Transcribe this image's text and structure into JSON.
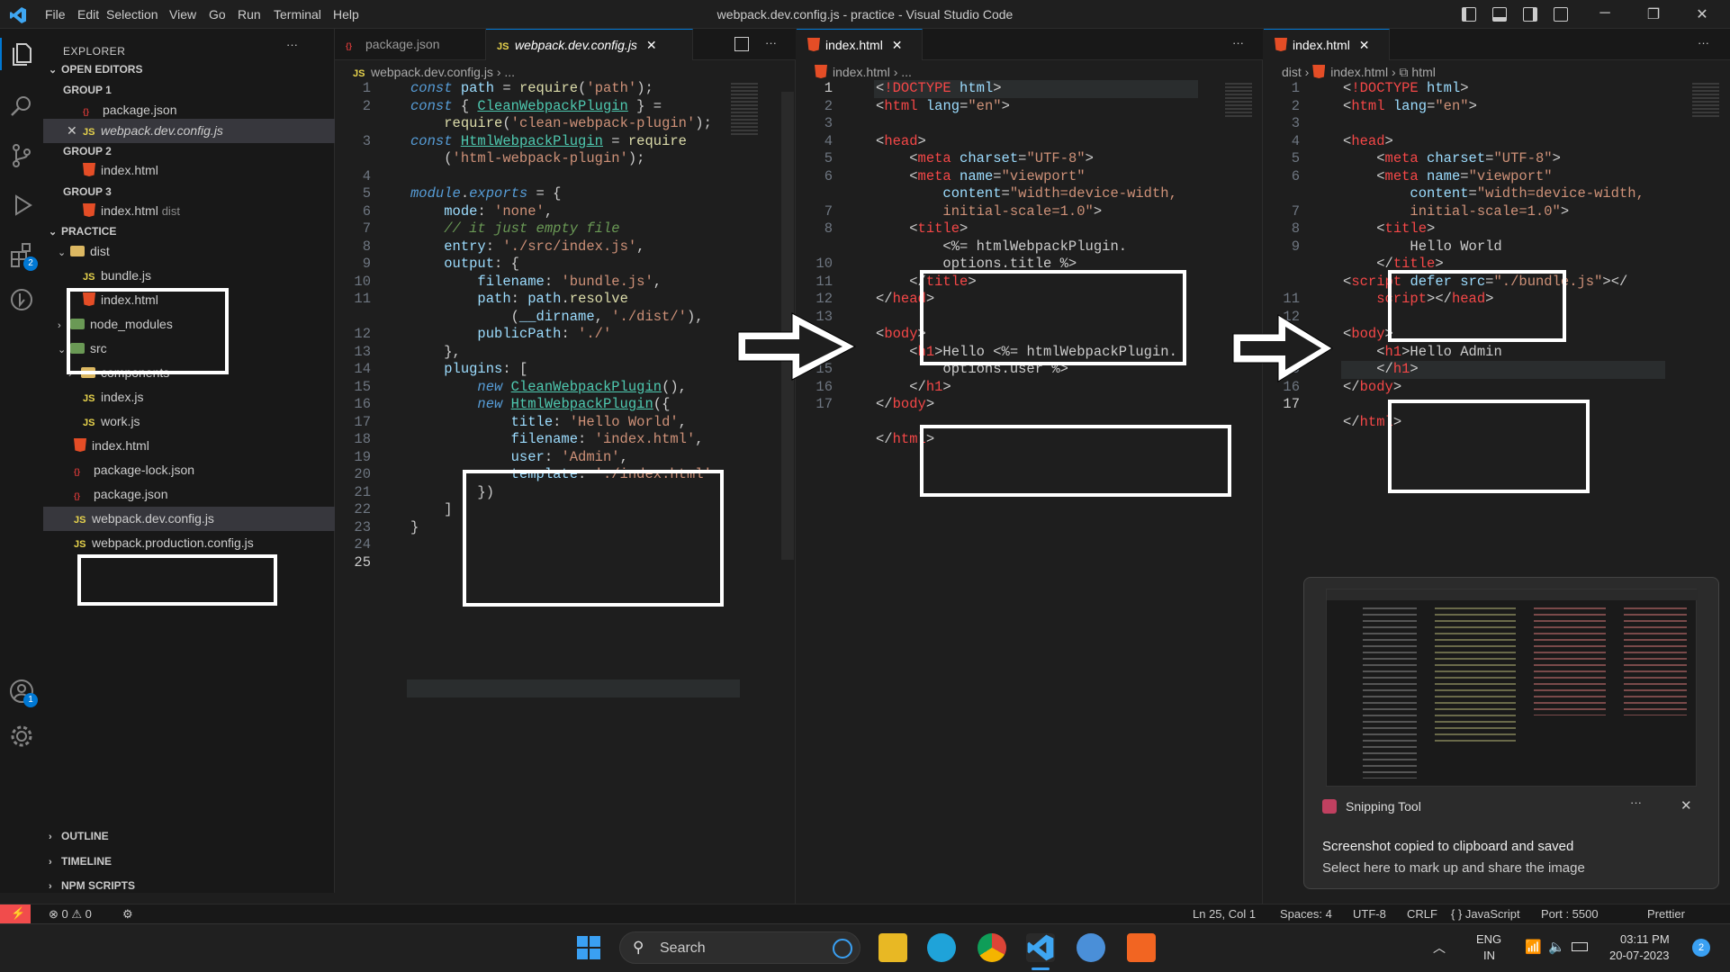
{
  "window": {
    "title": "webpack.dev.config.js - practice - Visual Studio Code",
    "menu": [
      "File",
      "Edit",
      "Selection",
      "View",
      "Go",
      "Run",
      "Terminal",
      "Help"
    ]
  },
  "sidebar": {
    "header": "EXPLORER",
    "open_editors": "OPEN EDITORS",
    "groups": [
      {
        "label": "GROUP 1",
        "files": [
          {
            "name": "package.json"
          },
          {
            "name": "webpack.dev.config.js"
          }
        ]
      },
      {
        "label": "GROUP 2",
        "files": [
          {
            "name": "index.html"
          }
        ]
      },
      {
        "label": "GROUP 3",
        "files": [
          {
            "name": "index.html",
            "hint": "dist"
          }
        ]
      }
    ],
    "project": "PRACTICE",
    "tree": [
      "dist",
      "bundle.js",
      "index.html",
      "node_modules",
      "src",
      "components",
      "index.js",
      "work.js",
      "index.html",
      "package-lock.json",
      "package.json",
      "webpack.dev.config.js",
      "webpack.production.config.js"
    ],
    "bottom_sections": [
      "OUTLINE",
      "TIMELINE",
      "NPM SCRIPTS"
    ],
    "badges": {
      "extensions": "2",
      "accounts": "1"
    }
  },
  "editor1": {
    "tabs": [
      "package.json",
      "webpack.dev.config.js"
    ],
    "breadcrumb": [
      "webpack.dev.config.js",
      "..."
    ],
    "line_numbers": [
      "1",
      "2",
      "",
      "3",
      "",
      "4",
      "5",
      "6",
      "7",
      "8",
      "9",
      "10",
      "11",
      "",
      "12",
      "13",
      "14",
      "15",
      "16",
      "17",
      "18",
      "19",
      "20",
      "21",
      "22",
      "23",
      "24",
      "25"
    ]
  },
  "editor2": {
    "tab": "index.html",
    "breadcrumb": [
      "index.html",
      "..."
    ],
    "line_numbers": [
      "1",
      "2",
      "3",
      "4",
      "5",
      "6",
      "",
      "7",
      "8",
      "",
      "10",
      "11",
      "12",
      "13",
      "",
      "14",
      "15",
      "16",
      "17"
    ]
  },
  "editor3": {
    "tab": "index.html",
    "breadcrumb": [
      "dist",
      "index.html",
      "html"
    ],
    "line_numbers": [
      "1",
      "2",
      "3",
      "4",
      "5",
      "6",
      "",
      "7",
      "8",
      "9",
      "",
      "",
      "11",
      "12",
      "13",
      "14",
      "15",
      "16",
      "17"
    ]
  },
  "status": {
    "errors": "0",
    "warnings": "0",
    "position": "Ln 25, Col 1",
    "spaces": "Spaces: 4",
    "encoding": "UTF-8",
    "eol": "CRLF",
    "language": "{ } JavaScript",
    "port": "Port : 5500",
    "prettier": "Prettier"
  },
  "toast": {
    "app": "Snipping Tool",
    "title": "Screenshot copied to clipboard and saved",
    "body": "Select here to mark up and share the image"
  },
  "taskbar": {
    "search": "Search",
    "lang1": "ENG",
    "lang2": "IN",
    "time": "03:11 PM",
    "date": "20-07-2023",
    "notif": "2"
  },
  "colors": {
    "accent": "#0078d4",
    "statusbar": "#181818",
    "remote": "#f14c4c"
  }
}
